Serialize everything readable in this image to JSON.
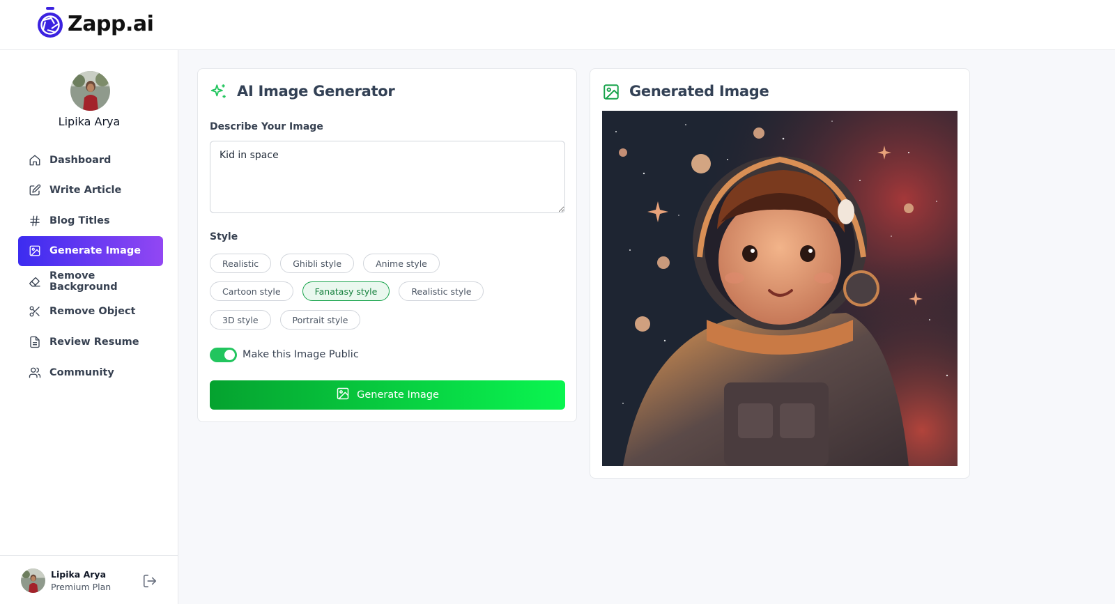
{
  "app": {
    "name": "Zapp.ai"
  },
  "user": {
    "name": "Lipika Arya",
    "plan": "Premium Plan"
  },
  "sidebar": {
    "items": [
      {
        "label": "Dashboard",
        "icon": "house-icon",
        "active": false
      },
      {
        "label": "Write Article",
        "icon": "edit-icon",
        "active": false
      },
      {
        "label": "Blog Titles",
        "icon": "hash-icon",
        "active": false
      },
      {
        "label": "Generate Image",
        "icon": "image-icon",
        "active": true
      },
      {
        "label": "Remove Background",
        "icon": "eraser-icon",
        "active": false
      },
      {
        "label": "Remove Object",
        "icon": "scissors-icon",
        "active": false
      },
      {
        "label": "Review Resume",
        "icon": "file-text-icon",
        "active": false
      },
      {
        "label": "Community",
        "icon": "users-icon",
        "active": false
      }
    ]
  },
  "generator": {
    "title": "AI Image Generator",
    "describe_label": "Describe Your Image",
    "prompt_value": "Kid in space",
    "style_label": "Style",
    "styles": [
      [
        "Realistic",
        "Ghibli style",
        "Anime style"
      ],
      [
        "Cartoon style",
        "Fanatasy style",
        "Realistic style"
      ],
      [
        "3D style",
        "Portrait style"
      ]
    ],
    "selected_style": "Fanatasy style",
    "public_label": "Make this Image Public",
    "public_on": true,
    "button_label": "Generate Image"
  },
  "result": {
    "title": "Generated Image"
  },
  "colors": {
    "accent_purple_start": "#3c2cf0",
    "accent_purple_end": "#9247f3",
    "accent_green": "#22c55e",
    "title_gray": "#334155"
  }
}
